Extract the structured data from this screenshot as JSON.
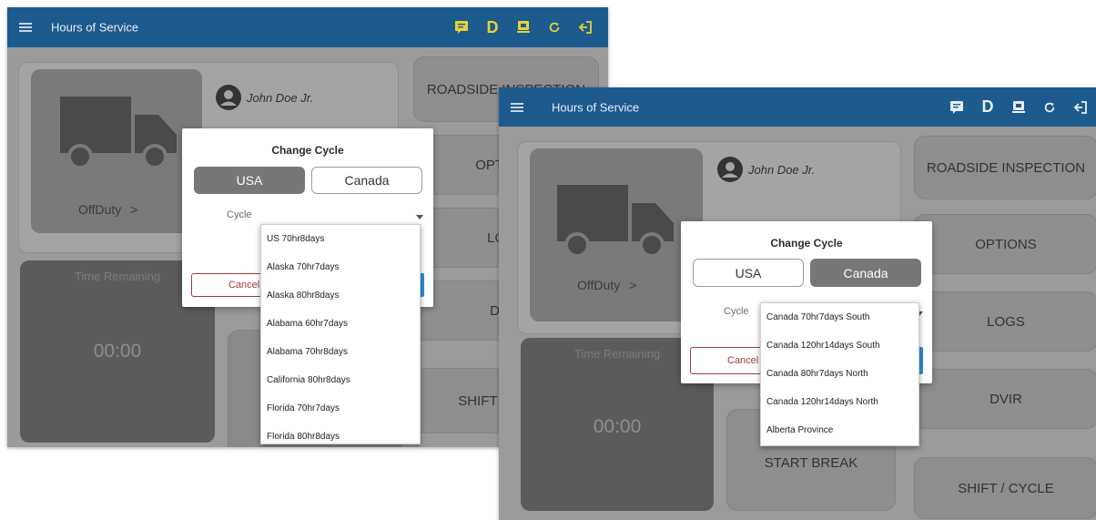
{
  "screen1": {
    "appbar": {
      "title": "Hours of Service",
      "d_indicator": "D",
      "d_color": "#e5d237"
    },
    "driver_name": "John Doe Jr.",
    "status": "OffDuty",
    "status_chevron": ">",
    "time_remaining_label": "Time Remaining",
    "time_remaining_value": "00:00",
    "buttons": [
      "ROADSIDE INSPECTION",
      "OPTIONS",
      "LOGS",
      "DVIR",
      "SHIFT / CYCLE"
    ],
    "dialog": {
      "title": "Change Cycle",
      "tab_usa": "USA",
      "tab_canada": "Canada",
      "selected_tab": "USA",
      "cycle_label": "Cycle",
      "cancel_label": "Cancel"
    },
    "cycle_options": [
      "US 70hr8days",
      "Alaska 70hr7days",
      "Alaska 80hr8days",
      "Alabama 60hr7days",
      "Alabama 70hr8days",
      "California 80hr8days",
      "Florida 70hr7days",
      "Florida 80hr8days"
    ]
  },
  "screen2": {
    "appbar": {
      "title": "Hours of Service",
      "d_indicator": "D",
      "d_color": "#e8eef4"
    },
    "driver_name": "John Doe Jr.",
    "status": "OffDuty",
    "status_chevron": ">",
    "time_remaining_label": "Time Remaining",
    "time_remaining_value": "00:00",
    "start_break_label": "START BREAK",
    "buttons": [
      "ROADSIDE INSPECTION",
      "OPTIONS",
      "LOGS",
      "DVIR",
      "SHIFT / CYCLE"
    ],
    "dialog": {
      "title": "Change Cycle",
      "tab_usa": "USA",
      "tab_canada": "Canada",
      "selected_tab": "Canada",
      "cycle_label": "Cycle",
      "cancel_label": "Cancel"
    },
    "cycle_options": [
      "Canada 70hr7days South",
      "Canada 120hr14days South",
      "Canada 80hr7days North",
      "Canada 120hr14days North",
      "Alberta Province"
    ]
  },
  "icons": [
    "menu-icon",
    "message-icon",
    "d-indicator",
    "eld-device-icon",
    "refresh-icon",
    "logout-icon",
    "driver-avatar-icon",
    "truck-icon"
  ]
}
